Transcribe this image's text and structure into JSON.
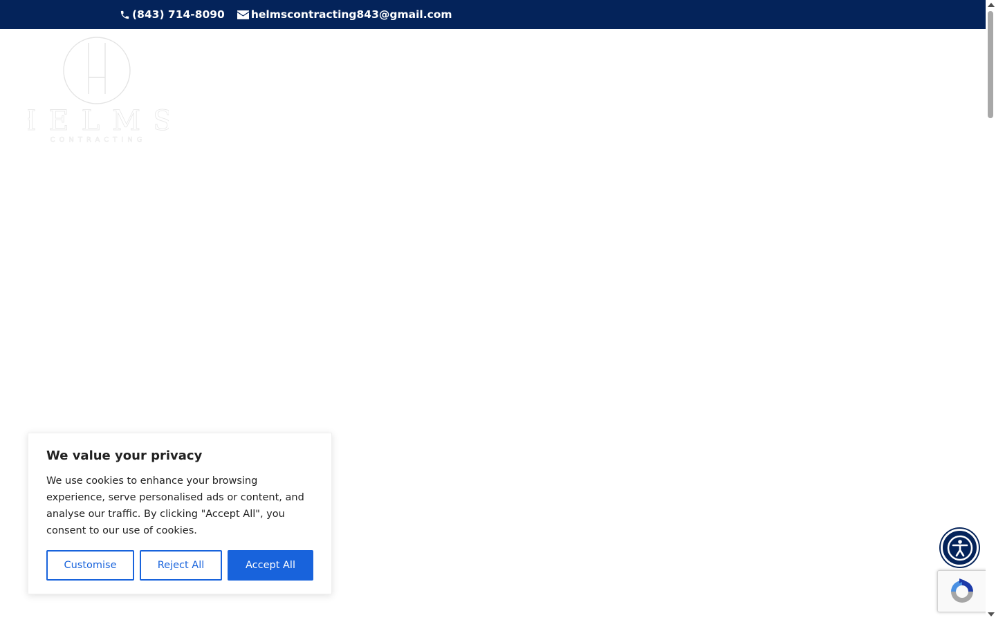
{
  "topbar": {
    "phone": "(843) 714-8090",
    "email": "helmscontracting843@gmail.com",
    "phone_icon": "phone-icon",
    "email_icon": "envelope-icon",
    "background": "#04235a"
  },
  "logo": {
    "wordmark": "HELMS",
    "tagline": "CONTRACTING"
  },
  "cookie_banner": {
    "title": "We value your privacy",
    "body": "We use cookies to enhance your browsing experience, serve personalised ads or content, and analyse our traffic. By clicking \"Accept All\", you consent to our use of cookies.",
    "customise_label": "Customise",
    "reject_label": "Reject All",
    "accept_label": "Accept All",
    "accent": "#1863dc"
  },
  "accessibility_widget": {
    "icon": "accessibility-icon"
  },
  "recaptcha": {
    "icon": "recaptcha-icon"
  }
}
